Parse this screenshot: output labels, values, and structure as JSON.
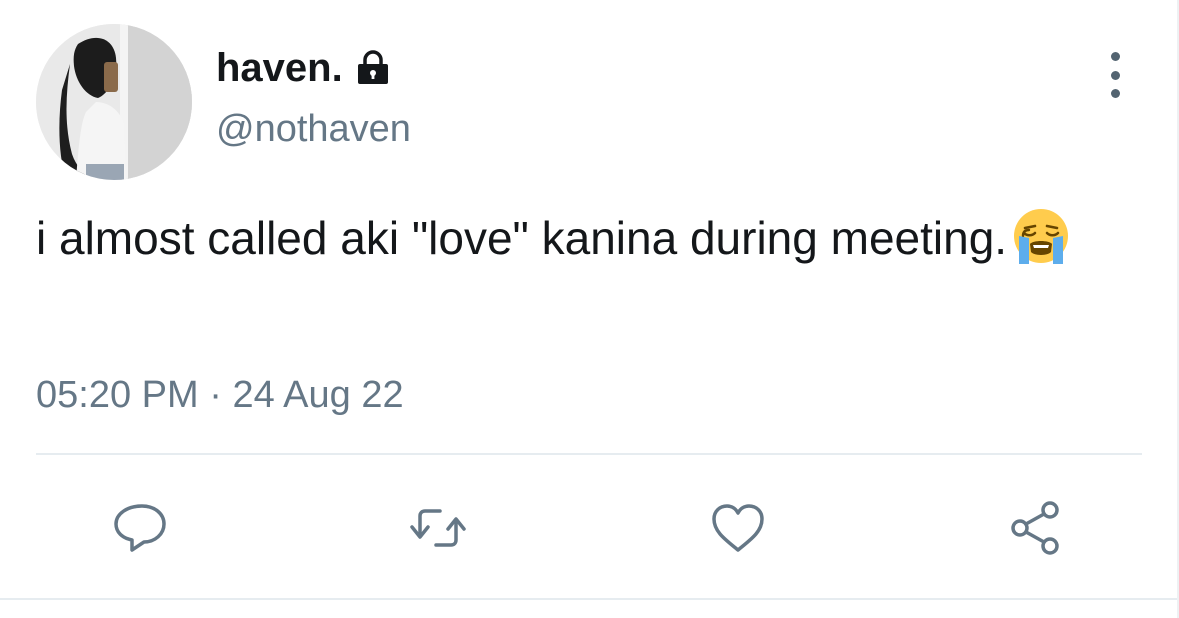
{
  "author": {
    "display_name": "haven.",
    "handle": "@nothaven",
    "protected_icon": "lock-icon",
    "avatar": "profile-photo"
  },
  "tweet": {
    "text": "i almost called aki \"love\" kanina during meeting.",
    "emoji": "loudly-crying-face-emoji",
    "time": "05:20 PM",
    "separator": "·",
    "date": "24 Aug 22"
  },
  "actions": {
    "reply_icon": "speech-bubble-icon",
    "retweet_icon": "retweet-icon",
    "like_icon": "heart-icon",
    "share_icon": "share-icon",
    "more_icon": "vertical-ellipsis-icon"
  },
  "colors": {
    "text_primary": "#14171a",
    "text_secondary": "#657786",
    "icon": "#657786",
    "divider": "#e6ecf0"
  }
}
